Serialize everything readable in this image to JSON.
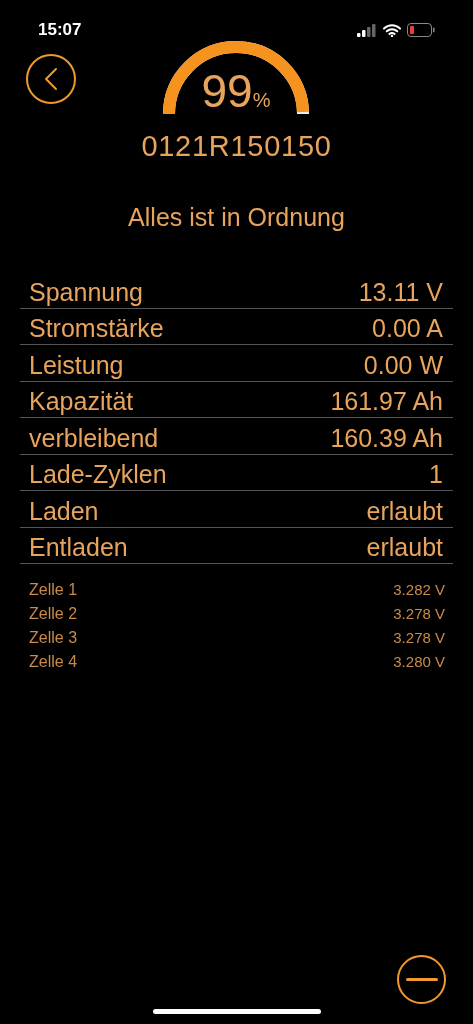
{
  "status_bar": {
    "time": "15:07"
  },
  "gauge": {
    "value": "99",
    "unit": "%"
  },
  "serial": "0121R150150",
  "status_message": "Alles ist in Ordnung",
  "readings": [
    {
      "label": "Spannung",
      "value": "13.11 V"
    },
    {
      "label": "Stromstärke",
      "value": "0.00 A"
    },
    {
      "label": "Leistung",
      "value": "0.00 W"
    },
    {
      "label": "Kapazität",
      "value": "161.97 Ah"
    },
    {
      "label": "verbleibend",
      "value": "160.39 Ah"
    },
    {
      "label": "Lade-Zyklen",
      "value": "1"
    },
    {
      "label": "Laden",
      "value": "erlaubt"
    },
    {
      "label": "Entladen",
      "value": "erlaubt"
    }
  ],
  "cells": [
    {
      "label": "Zelle 1",
      "value": "3.282 V"
    },
    {
      "label": "Zelle 2",
      "value": "3.278 V"
    },
    {
      "label": "Zelle 3",
      "value": "3.278 V"
    },
    {
      "label": "Zelle 4",
      "value": "3.280 V"
    }
  ]
}
